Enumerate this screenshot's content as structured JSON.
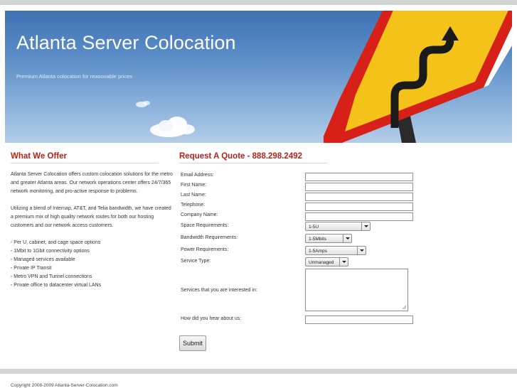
{
  "header": {
    "title": "Atlanta Server Colocation",
    "tagline": "Premium Atlanta colocation for reasonable prices"
  },
  "offer": {
    "heading": "What We Offer",
    "paragraph1": "Atlanta Server Colocation offers custom colocation solutions for the metro and greater Atlanta areas. Our network operations center offers 24/7/365 network monitoring, and pro-active response to problems.",
    "paragraph2": "Utilizing a blend of Internap, AT&T, and Telia bandwidth, we have created a premium mix of high quality network routes for both our hosting customers and our network access customers.",
    "list": [
      "- Per U, cabinet, and cage space options",
      "- 1Mbit to 1Gbit connectivity options",
      "- Managed services available",
      "- Private IP Transit",
      "- Metro VPN and Tunnel connections",
      "- Private office to datacenter virtual LANs"
    ]
  },
  "quote": {
    "heading": "Request A Quote - 888.298.2492",
    "email_label": "Email Address:",
    "first_name_label": "First Name:",
    "last_name_label": "Last Name:",
    "telephone_label": "Telephone:",
    "company_label": "Company Name:",
    "space_label": "Space Requirements:",
    "space_value": "1-5U",
    "bandwidth_label": "Bandwidth Requirements:",
    "bandwidth_value": "1-5Mbits",
    "power_label": "Power Requirements:",
    "power_value": "1-5Amps",
    "service_type_label": "Service Type:",
    "service_type_value": "Unmanaged",
    "services_label": "Services that you are interested in:",
    "hear_label": "How did you hear about us:",
    "submit_label": "Submit"
  },
  "footer": {
    "copyright": "Copyright 2008-2009 Atlanta-Server-Colocation.com"
  },
  "colors": {
    "heading_red": "#b8221b",
    "sky_blue": "#5b8dc7",
    "sign_yellow": "#f5c21a",
    "sign_red": "#d62018"
  }
}
